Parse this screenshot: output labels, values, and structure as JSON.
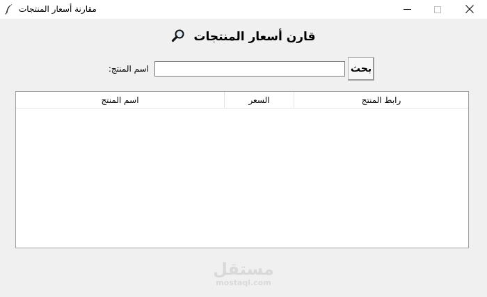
{
  "window": {
    "title": "مقارنة أسعار المنتجات",
    "icon": "feather-icon"
  },
  "window_controls": {
    "minimize_icon": "minimize-icon",
    "maximize_icon": "maximize-icon",
    "close_icon": "close-icon"
  },
  "heading": {
    "text": "قارن أسعار المنتجات",
    "icon": "magnifier-icon"
  },
  "search": {
    "label": ":اسم المنتج",
    "value": "",
    "placeholder": "",
    "button_label": "بحث"
  },
  "table": {
    "columns": [
      "اسم المنتج",
      "السعر",
      "رابط المنتج"
    ],
    "rows": []
  },
  "watermark": {
    "arabic": "مستقل",
    "latin": "mostaql.com"
  }
}
